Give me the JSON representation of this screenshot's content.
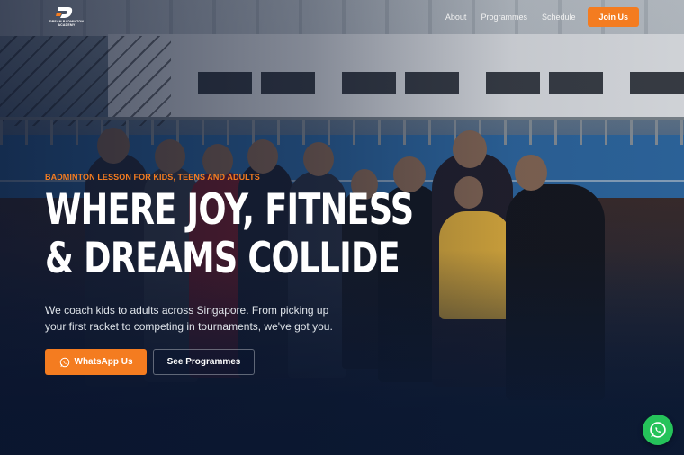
{
  "brand": {
    "logo_text": "DREAM BADMINTON ACADEMY",
    "accent": "#f47c20",
    "whatsapp_green": "#25c35a"
  },
  "nav": {
    "links": [
      "About",
      "Programmes",
      "Schedule"
    ],
    "cta": "Join Us"
  },
  "hero": {
    "eyebrow": "BADMINTON LESSON FOR KIDS, TEENS AND ADULTS",
    "headline_line1": "WHERE JOY, FITNESS",
    "headline_line2": "& DREAMS COLLIDE",
    "description": "We coach kids to adults across Singapore. From picking up your first racket to competing in tournaments, we've got you.",
    "primary_button": "WhatsApp Us",
    "secondary_button": "See Programmes"
  },
  "icons": {
    "primary_button_icon": "whatsapp-icon",
    "floating_button_icon": "whatsapp-icon"
  }
}
